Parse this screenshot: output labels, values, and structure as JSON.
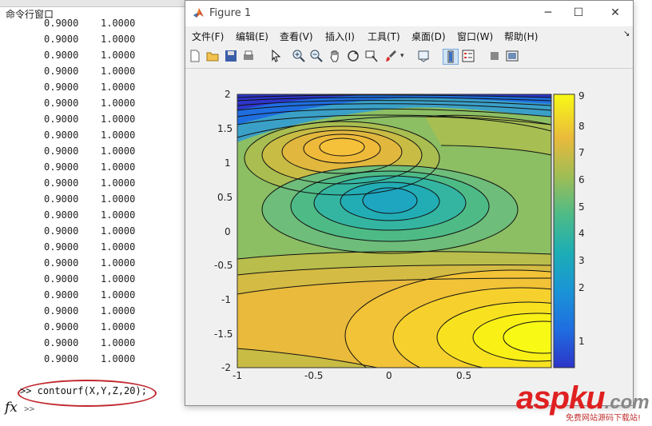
{
  "command_window": {
    "title": "命令行窗口",
    "rows": [
      [
        "0.9000",
        "1.0000"
      ],
      [
        "0.9000",
        "1.0000"
      ],
      [
        "0.9000",
        "1.0000"
      ],
      [
        "0.9000",
        "1.0000"
      ],
      [
        "0.9000",
        "1.0000"
      ],
      [
        "0.9000",
        "1.0000"
      ],
      [
        "0.9000",
        "1.0000"
      ],
      [
        "0.9000",
        "1.0000"
      ],
      [
        "0.9000",
        "1.0000"
      ],
      [
        "0.9000",
        "1.0000"
      ],
      [
        "0.9000",
        "1.0000"
      ],
      [
        "0.9000",
        "1.0000"
      ],
      [
        "0.9000",
        "1.0000"
      ],
      [
        "0.9000",
        "1.0000"
      ],
      [
        "0.9000",
        "1.0000"
      ],
      [
        "0.9000",
        "1.0000"
      ],
      [
        "0.9000",
        "1.0000"
      ],
      [
        "0.9000",
        "1.0000"
      ],
      [
        "0.9000",
        "1.0000"
      ],
      [
        "0.9000",
        "1.0000"
      ],
      [
        "0.9000",
        "1.0000"
      ],
      [
        "0.9000",
        "1.0000"
      ]
    ],
    "last_command": ">> contourf(X,Y,Z,20);",
    "fx_label": "fx",
    "prompt": ">>"
  },
  "figure": {
    "title": "Figure 1",
    "menu": [
      "文件(F)",
      "编辑(E)",
      "查看(V)",
      "插入(I)",
      "工具(T)",
      "桌面(D)",
      "窗口(W)",
      "帮助(H)"
    ],
    "toolbar_icons": [
      "new-icon",
      "open-icon",
      "save-icon",
      "print-icon",
      "pointer-icon",
      "zoom-in-icon",
      "zoom-out-icon",
      "pan-icon",
      "rotate-icon",
      "data-cursor-icon",
      "brush-icon",
      "link-icon",
      "colorbar-icon",
      "legend-icon",
      "hide-tools-icon",
      "show-tools-icon"
    ],
    "x_ticks": [
      "-1",
      "-0.5",
      "0",
      "0.5"
    ],
    "y_ticks": [
      "2",
      "1.5",
      "1",
      "0.5",
      "0",
      "-0.5",
      "-1",
      "-1.5",
      "-2"
    ],
    "colorbar_ticks": [
      "9",
      "8",
      "7",
      "6",
      "5",
      "4",
      "3",
      "2",
      "1"
    ]
  },
  "chart_data": {
    "type": "heatmap",
    "plot": "contourf",
    "levels": 20,
    "xlim": [
      -1,
      1
    ],
    "ylim": [
      -2,
      2
    ],
    "colorbar_range": [
      0.8,
      9.1
    ],
    "colormap": "parula",
    "features": [
      {
        "kind": "max",
        "x": -0.3,
        "y": 1.25,
        "value": 7.1
      },
      {
        "kind": "min",
        "x": 0.0,
        "y": 0.4,
        "value": 4.1
      },
      {
        "kind": "max",
        "x": 0.85,
        "y": -1.6,
        "value": 9.0
      },
      {
        "kind": "min",
        "x": -1.0,
        "y": 2.0,
        "value": 0.8
      }
    ]
  },
  "watermark": {
    "main": "asp",
    "suffix": "ku",
    "domain": ".com",
    "sub": "免费网站源码下载站!"
  },
  "colors": {
    "prompt_circle": "#c0272d",
    "watermark": "#e02020"
  }
}
